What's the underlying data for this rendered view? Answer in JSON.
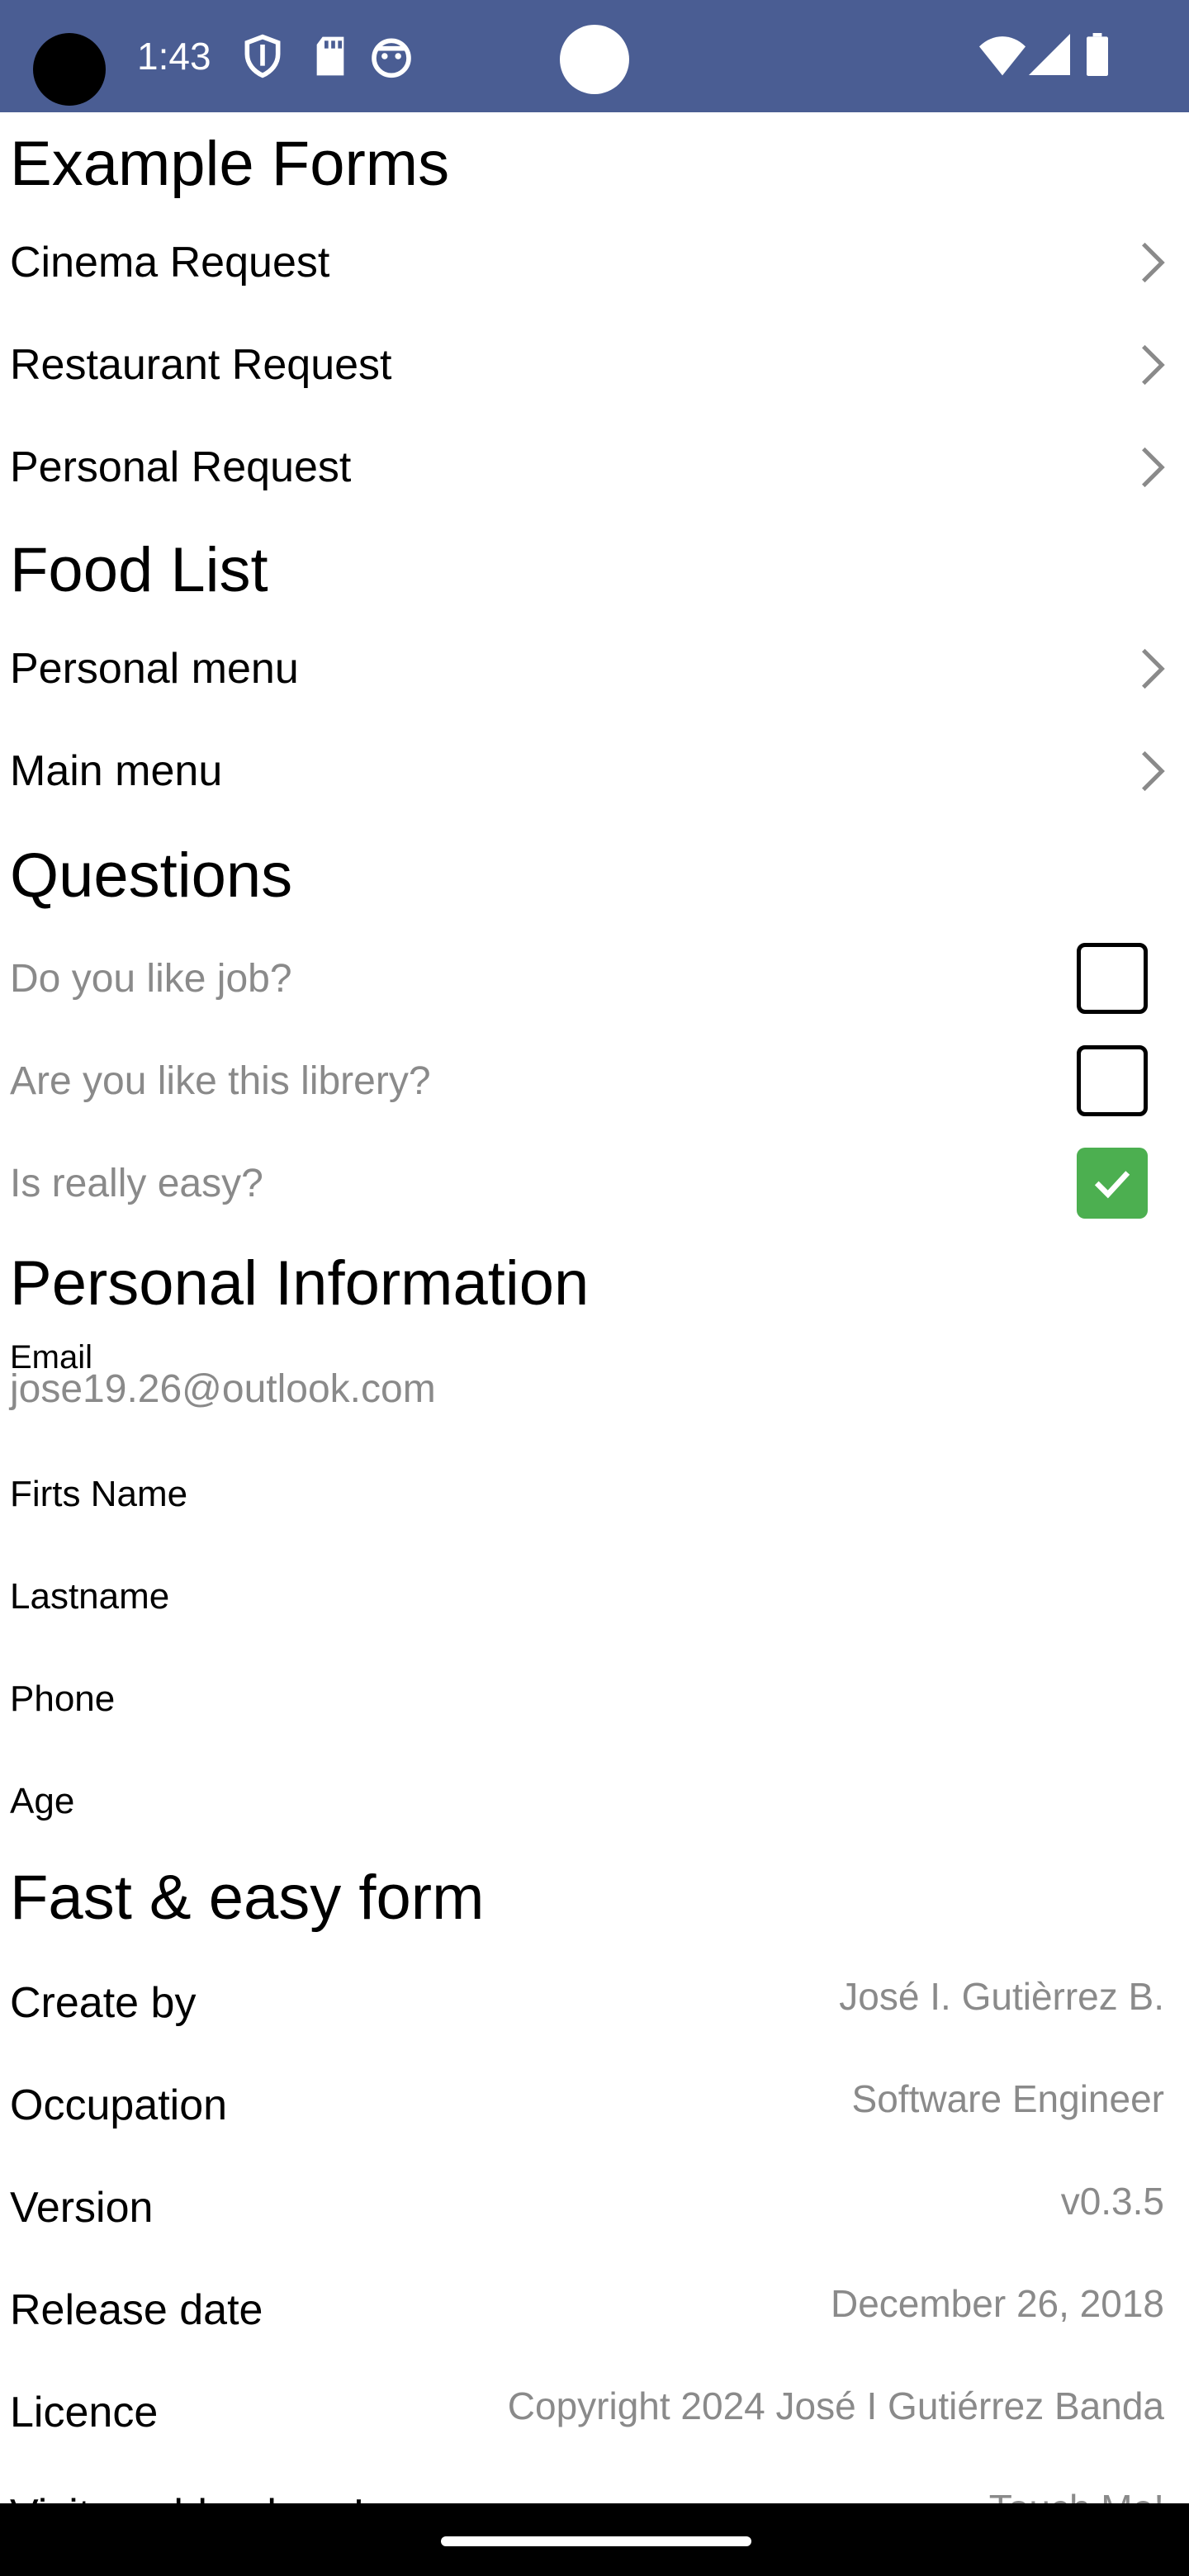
{
  "status_bar": {
    "time": "1:43",
    "icons": [
      "shield-icon",
      "sd-card-icon",
      "android-debug-icon",
      "wifi-icon",
      "cell-signal-icon",
      "battery-icon"
    ]
  },
  "sections": {
    "example_forms": {
      "title": "Example Forms",
      "items": [
        {
          "label": "Cinema Request"
        },
        {
          "label": "Restaurant Request"
        },
        {
          "label": "Personal Request"
        }
      ]
    },
    "food_list": {
      "title": "Food List",
      "items": [
        {
          "label": "Personal menu"
        },
        {
          "label": "Main menu"
        }
      ]
    },
    "questions": {
      "title": "Questions",
      "items": [
        {
          "label": "Do you like job?",
          "checked": false
        },
        {
          "label": "Are you like this librery?",
          "checked": false
        },
        {
          "label": "Is really easy?",
          "checked": true
        }
      ]
    },
    "personal_info": {
      "title": "Personal Information",
      "email_label": "Email",
      "email_value": "jose19.26@outlook.com",
      "fields": [
        {
          "label": "Firts Name"
        },
        {
          "label": "Lastname"
        },
        {
          "label": "Phone"
        },
        {
          "label": "Age"
        }
      ]
    },
    "about": {
      "title": "Fast & easy form",
      "rows": [
        {
          "key": "Create by",
          "value": "José I. Gutièrrez B."
        },
        {
          "key": "Occupation",
          "value": "Software Engineer"
        },
        {
          "key": "Version",
          "value": "v0.3.5"
        },
        {
          "key": "Release date",
          "value": "December 26, 2018"
        },
        {
          "key": "Licence",
          "value": "Copyright 2024 José I Gutiérrez Banda"
        },
        {
          "key": "Visit me blog here!",
          "value": "Touch Me!"
        }
      ]
    }
  },
  "colors": {
    "status_bar": "#4a5d93",
    "checked": "#4caf50",
    "muted_text": "#8a8a8a"
  }
}
